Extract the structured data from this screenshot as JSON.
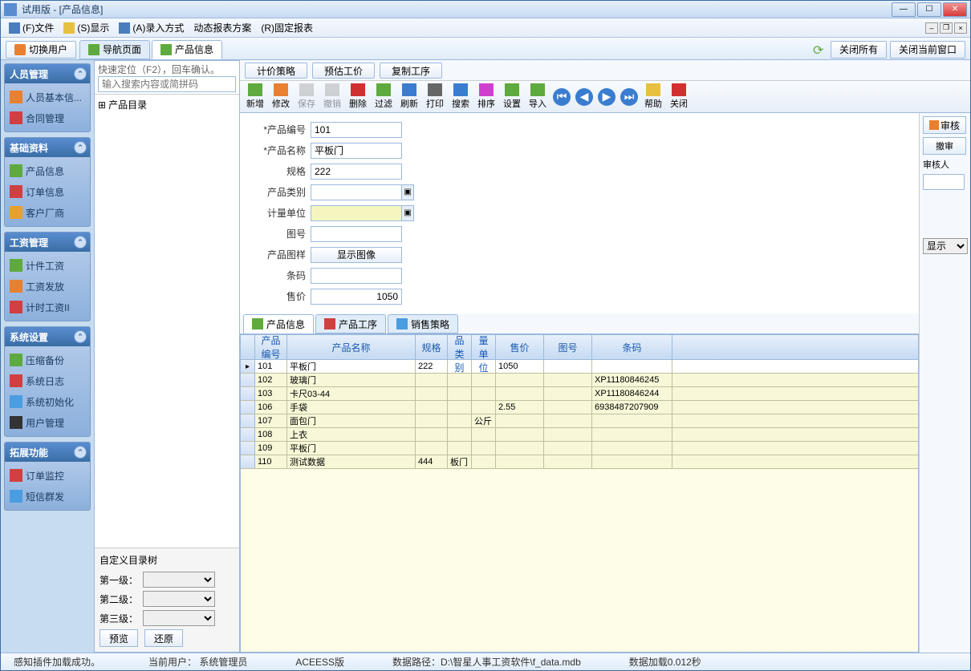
{
  "window": {
    "title": "试用版 - [产品信息]"
  },
  "menu": [
    {
      "icon": "#4a7dbb",
      "label": "(F)文件"
    },
    {
      "icon": "#e8c040",
      "label": "(S)显示"
    },
    {
      "icon": "#4a7dbb",
      "label": "(A)录入方式"
    },
    {
      "icon": "",
      "label": "动态报表方案"
    },
    {
      "icon": "",
      "label": "(R)固定报表"
    }
  ],
  "tabstrip": {
    "switch_user": "切换用户",
    "tabs": [
      {
        "label": "导航页面",
        "icon": "#5eaa3e"
      },
      {
        "label": "产品信息",
        "icon": "#5eaa3e",
        "active": true
      }
    ],
    "refresh": "⟳",
    "close_all": "关闭所有",
    "close_current": "关闭当前窗口"
  },
  "sidebar": [
    {
      "title": "人员管理",
      "items": [
        {
          "icon": "#e88030",
          "label": "人员基本信..."
        },
        {
          "icon": "#d04040",
          "label": "合同管理"
        }
      ]
    },
    {
      "title": "基础资料",
      "items": [
        {
          "icon": "#5eaa3e",
          "label": "产品信息"
        },
        {
          "icon": "#d04040",
          "label": "订单信息"
        },
        {
          "icon": "#e8a030",
          "label": "客户厂商"
        }
      ]
    },
    {
      "title": "工资管理",
      "items": [
        {
          "icon": "#5eaa3e",
          "label": "计件工资"
        },
        {
          "icon": "#e88030",
          "label": "工资发放"
        },
        {
          "icon": "#d04040",
          "label": "计时工资II"
        }
      ]
    },
    {
      "title": "系统设置",
      "items": [
        {
          "icon": "#5eaa3e",
          "label": "压缩备份"
        },
        {
          "icon": "#d04040",
          "label": "系统日志"
        },
        {
          "icon": "#4a9de0",
          "label": "系统初始化"
        },
        {
          "icon": "#333",
          "label": "用户管理"
        }
      ]
    },
    {
      "title": "拓展功能",
      "items": [
        {
          "icon": "#d04040",
          "label": "订单监控"
        },
        {
          "icon": "#4a9de0",
          "label": "短信群发"
        }
      ]
    }
  ],
  "tree": {
    "hint": "快速定位（F2），回车确认。",
    "placeholder": "输入搜索内容或简拼码",
    "root": "产品目录",
    "custom_title": "自定义目录树",
    "level1": "第一级：",
    "level2": "第二级：",
    "level3": "第三级：",
    "preview": "预览",
    "restore": "还原"
  },
  "topbuttons": [
    "计价策略",
    "预估工价",
    "复制工序"
  ],
  "toolbar": [
    {
      "label": "新增",
      "color": "#5eaa3e"
    },
    {
      "label": "修改",
      "color": "#e88030"
    },
    {
      "label": "保存",
      "color": "#999",
      "disabled": true
    },
    {
      "label": "撤销",
      "color": "#999",
      "disabled": true
    },
    {
      "label": "删除",
      "color": "#d03030"
    },
    {
      "label": "过滤",
      "color": "#5eaa3e"
    },
    {
      "label": "刷新",
      "color": "#3a7dd0"
    },
    {
      "label": "打印",
      "color": "#666"
    },
    {
      "label": "搜索",
      "color": "#3a7dd0"
    },
    {
      "label": "排序",
      "color": "#d040d0"
    },
    {
      "label": "设置",
      "color": "#5eaa3e"
    },
    {
      "label": "导入",
      "color": "#5eaa3e"
    }
  ],
  "navarrows": [
    "⏮",
    "◀",
    "▶",
    "⏭"
  ],
  "toolbar2": [
    {
      "label": "帮助",
      "color": "#e8c040"
    },
    {
      "label": "关闭",
      "color": "#d03030"
    }
  ],
  "form": {
    "f1": {
      "label": "*产品编号",
      "value": "101"
    },
    "f2": {
      "label": "*产品名称",
      "value": "平板门"
    },
    "f3": {
      "label": "规格",
      "value": "222"
    },
    "f4": {
      "label": "产品类别",
      "value": ""
    },
    "f5": {
      "label": "计量单位",
      "value": ""
    },
    "f6": {
      "label": "图号",
      "value": ""
    },
    "f7": {
      "label": "产品图样",
      "btn": "显示图像"
    },
    "f8": {
      "label": "条码",
      "value": ""
    },
    "f9": {
      "label": "售价",
      "value": "1050"
    }
  },
  "detailtabs": [
    {
      "label": "产品信息",
      "icon": "#5eaa3e",
      "active": true
    },
    {
      "label": "产品工序",
      "icon": "#d04040"
    },
    {
      "label": "销售策略",
      "icon": "#4a9de0"
    }
  ],
  "grid": {
    "headers": [
      "产品编号",
      "产品名称",
      "规格",
      "产品类别",
      "计量单位",
      "售价",
      "图号",
      "条码"
    ],
    "rows": [
      {
        "sel": true,
        "c": [
          "101",
          "平板门",
          "222",
          "",
          "",
          "1050",
          "",
          ""
        ]
      },
      {
        "c": [
          "102",
          "玻璃门",
          "",
          "",
          "",
          "",
          "",
          "XP11180846245"
        ]
      },
      {
        "c": [
          "103",
          "卡尺03-44",
          "",
          "",
          "",
          "",
          "",
          "XP11180846244"
        ]
      },
      {
        "c": [
          "106",
          "手袋",
          "",
          "",
          "",
          "2.55",
          "",
          "6938487207909"
        ]
      },
      {
        "c": [
          "107",
          "面包门",
          "",
          "",
          "公斤",
          "",
          "",
          ""
        ]
      },
      {
        "c": [
          "108",
          "上衣",
          "",
          "",
          "",
          "",
          "",
          ""
        ]
      },
      {
        "c": [
          "109",
          "平板门",
          "",
          "",
          "",
          "",
          "",
          ""
        ]
      },
      {
        "c": [
          "110",
          "测试数据",
          "444",
          "板门",
          "",
          "",
          "",
          ""
        ]
      }
    ]
  },
  "rightpanel": {
    "approve": "审核",
    "revoke": "撤审",
    "approver": "审核人",
    "display": "显示"
  },
  "status": {
    "left": "感知插件加载成功。",
    "user": "当前用户： 系统管理员",
    "ver": "ACEESS版",
    "path": "数据路径：D:\\智星人事工资软件\\f_data.mdb",
    "load": "数据加载0.012秒"
  }
}
